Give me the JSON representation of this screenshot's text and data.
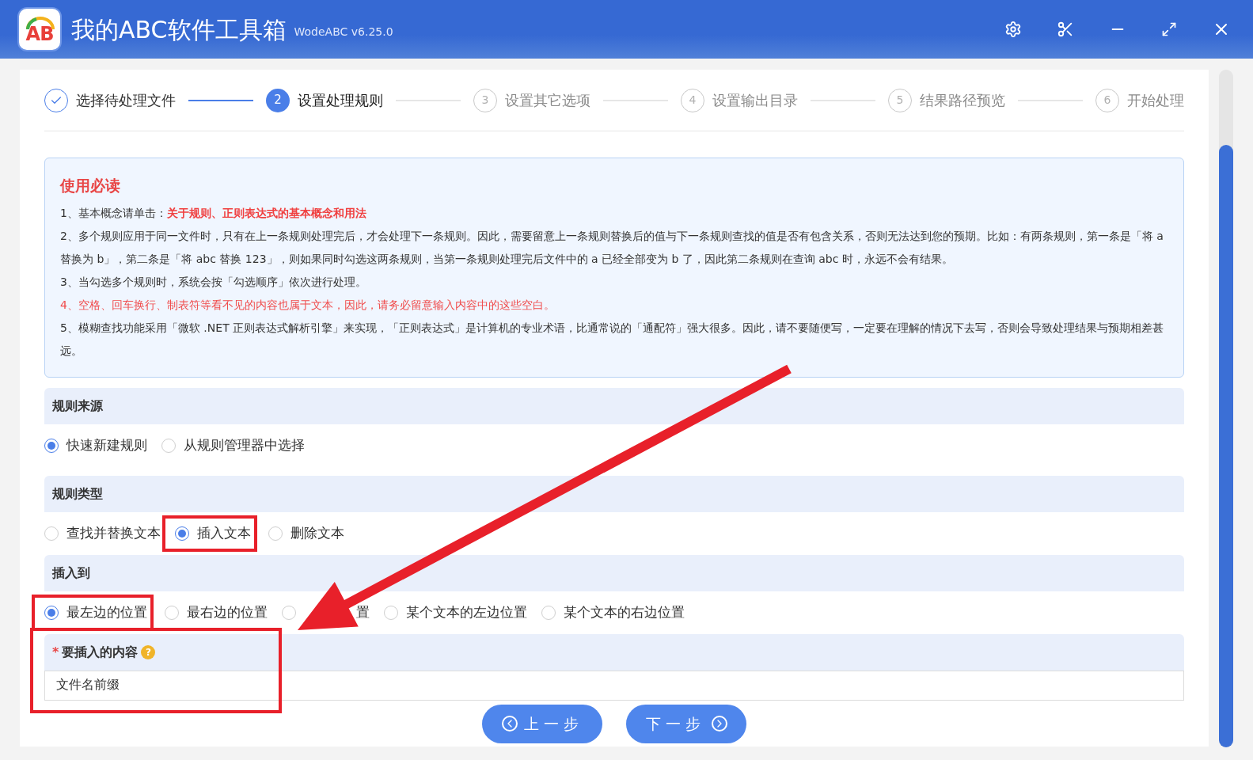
{
  "window": {
    "logo_text": "AB",
    "title": "我的ABC软件工具箱",
    "version": "WodeABC v6.25.0"
  },
  "steps": [
    {
      "label": "选择待处理文件",
      "done": true,
      "selected": false
    },
    {
      "number": "2",
      "label": "设置处理规则",
      "done": false,
      "selected": true
    },
    {
      "number": "3",
      "label": "设置其它选项",
      "done": false,
      "selected": false
    },
    {
      "number": "4",
      "label": "设置输出目录",
      "done": false,
      "selected": false
    },
    {
      "number": "5",
      "label": "结果路径预览",
      "done": false,
      "selected": false
    },
    {
      "number": "6",
      "label": "开始处理",
      "done": false,
      "selected": false
    }
  ],
  "notice": {
    "title": "使用必读",
    "items": [
      {
        "text": "1、基本概念请单击：",
        "link": "关于规则、正则表达式的基本概念和用法",
        "highlighted": false
      },
      {
        "text": "2、多个规则应用于同一文件时，只有在上一条规则处理完后，才会处理下一条规则。因此，需要留意上一条规则替换后的值与下一条规则查找的值是否有包含关系，否则无法达到您的预期。比如：有两条规则，第一条是「将 a 替换为 b」，第二条是「将 abc 替换 123」，则如果同时勾选这两条规则，当第一条规则处理完后文件中的 a 已经全部变为 b 了，因此第二条规则在查询 abc 时，永远不会有结果。",
        "highlighted": false
      },
      {
        "text": "3、当勾选多个规则时，系统会按「勾选顺序」依次进行处理。",
        "highlighted": false
      },
      {
        "text": "4、空格、回车换行、制表符等看不见的内容也属于文本，因此，请务必留意输入内容中的这些空白。",
        "highlighted": true
      },
      {
        "text": "5、模糊查找功能采用「微软 .NET 正则表达式解析引擎」来实现，「正则表达式」是计算机的专业术语，比通常说的「通配符」强大很多。因此，请不要随便写，一定要在理解的情况下去写，否则会导致处理结果与预期相差甚远。",
        "highlighted": false
      }
    ]
  },
  "sections": [
    {
      "title": "规则来源",
      "options": [
        {
          "label": "快速新建规则",
          "selected": true,
          "annotated": false
        },
        {
          "label": "从规则管理器中选择",
          "selected": false,
          "annotated": false
        }
      ]
    },
    {
      "title": "规则类型",
      "options": [
        {
          "label": "查找并替换文本",
          "selected": false,
          "annotated": false
        },
        {
          "label": "插入文本",
          "selected": true,
          "annotated": true
        },
        {
          "label": "删除文本",
          "selected": false,
          "annotated": false
        }
      ]
    },
    {
      "title": "插入到",
      "options": [
        {
          "label": "最左边的位置",
          "selected": true,
          "annotated": true
        },
        {
          "label": "最右边的位置",
          "selected": false,
          "annotated": false
        },
        {
          "label": "置",
          "selected": false,
          "annotated": false,
          "kind": "partly_covered"
        },
        {
          "label": "某个文本的左边位置",
          "selected": false,
          "annotated": false
        },
        {
          "label": "某个文本的右边位置",
          "selected": false,
          "annotated": false
        }
      ]
    }
  ],
  "content_field": {
    "required_mark": "*",
    "label": "要插入的内容",
    "help": "?",
    "value": "文件名前缀",
    "annotated": true
  },
  "buttons": [
    {
      "kind": "prev",
      "label": "上一步"
    },
    {
      "kind": "next",
      "label": "下一步"
    }
  ]
}
